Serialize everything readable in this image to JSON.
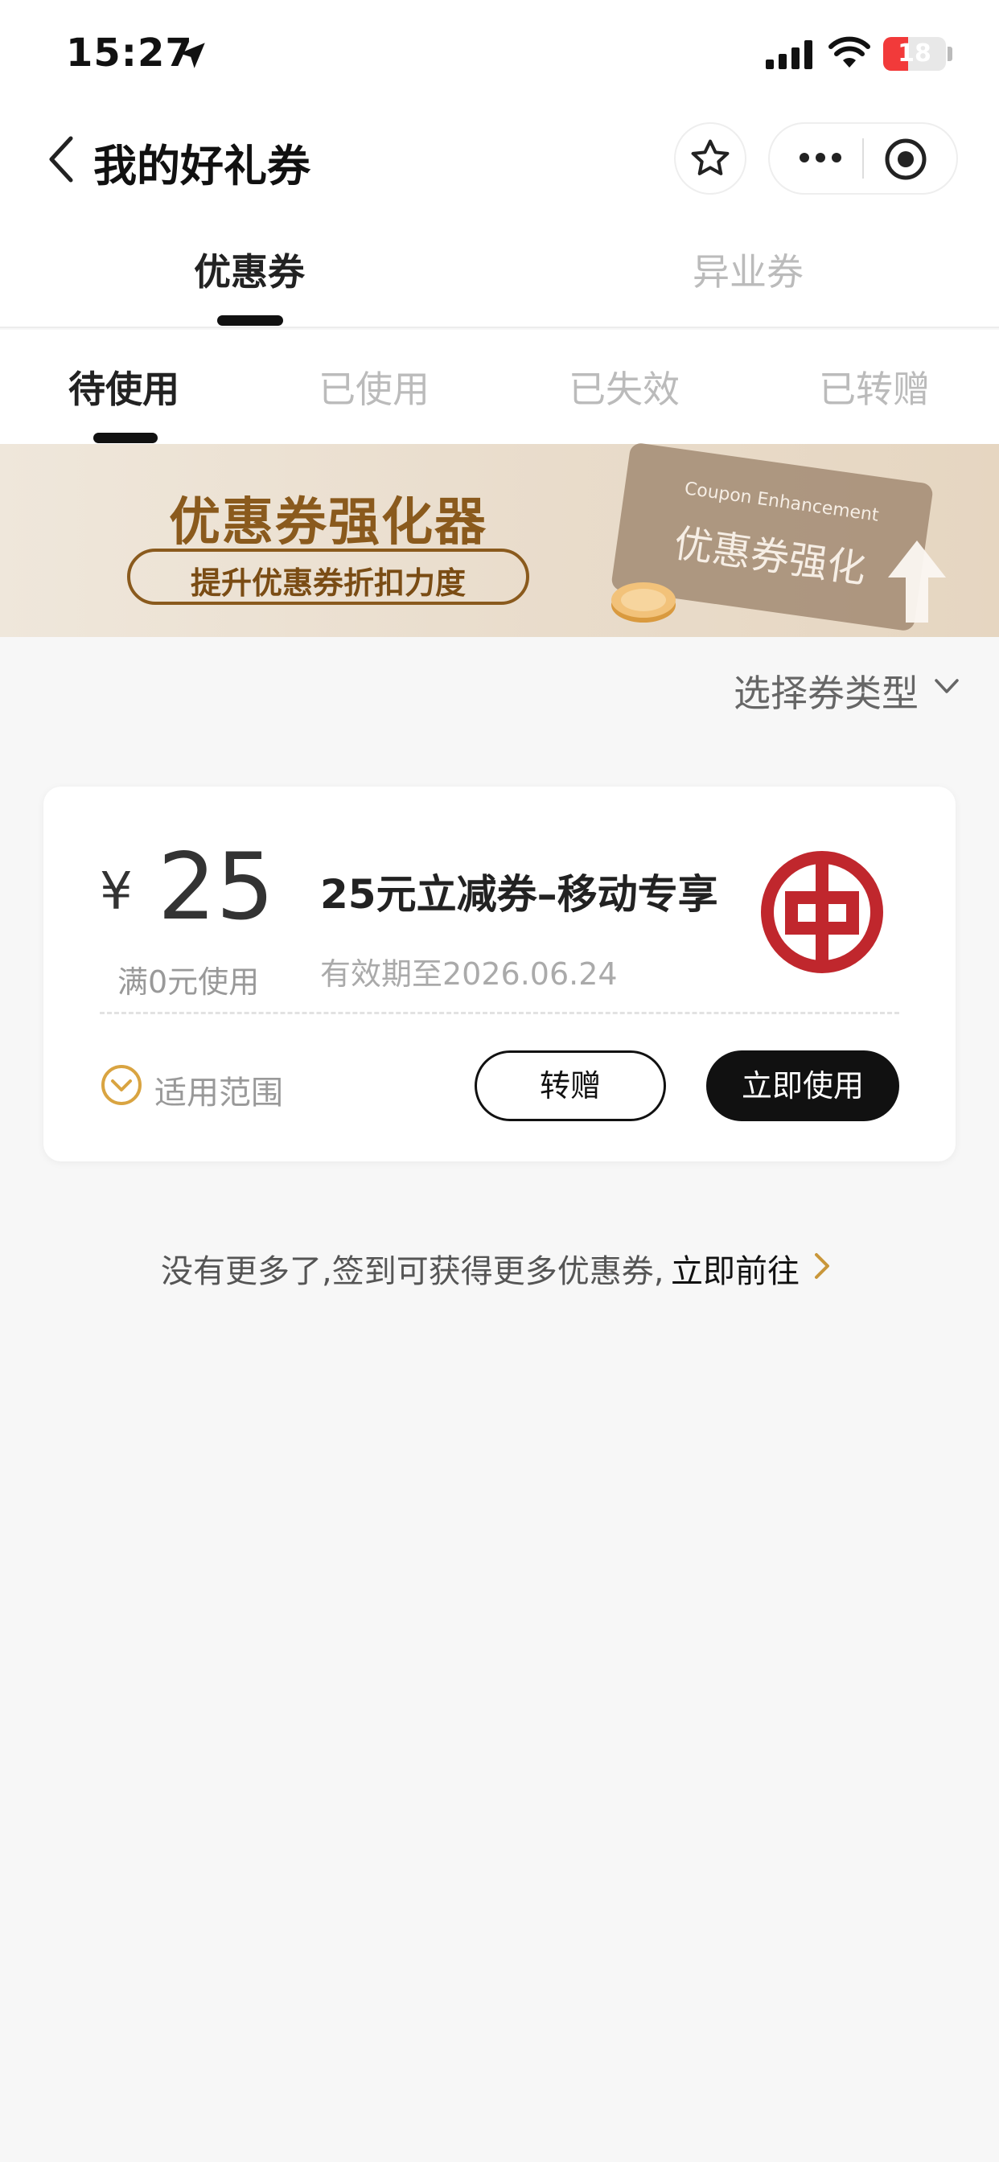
{
  "status_bar": {
    "time": "15:27",
    "battery": "18",
    "battery_level": 0.18
  },
  "nav": {
    "title": "我的好礼券"
  },
  "main_tabs": [
    {
      "label": "优惠券",
      "active": true
    },
    {
      "label": "异业券",
      "active": false
    }
  ],
  "sub_tabs": [
    {
      "label": "待使用",
      "active": true
    },
    {
      "label": "已使用",
      "active": false
    },
    {
      "label": "已失效",
      "active": false
    },
    {
      "label": "已转赠",
      "active": false
    }
  ],
  "banner": {
    "title": "优惠券强化器",
    "subtitle": "提升优惠券折扣力度",
    "card_en": "Coupon Enhancement",
    "card_cn": "优惠券强化"
  },
  "filter": {
    "label": "选择券类型"
  },
  "coupon": {
    "currency": "¥",
    "amount": "25",
    "condition": "满0元使用",
    "title": "25元立减券–移动专享",
    "validity": "有效期至2026.06.24",
    "scope_label": "适用范围",
    "transfer_label": "转赠",
    "use_label": "立即使用"
  },
  "footer": {
    "hint": "没有更多了,签到可获得更多优惠券,",
    "link": "立即前往"
  },
  "colors": {
    "brand_gold": "#8a5a1d",
    "bank_red": "#c0272d",
    "battery_red": "#f23a3a",
    "scope_icon": "#d9a441"
  }
}
